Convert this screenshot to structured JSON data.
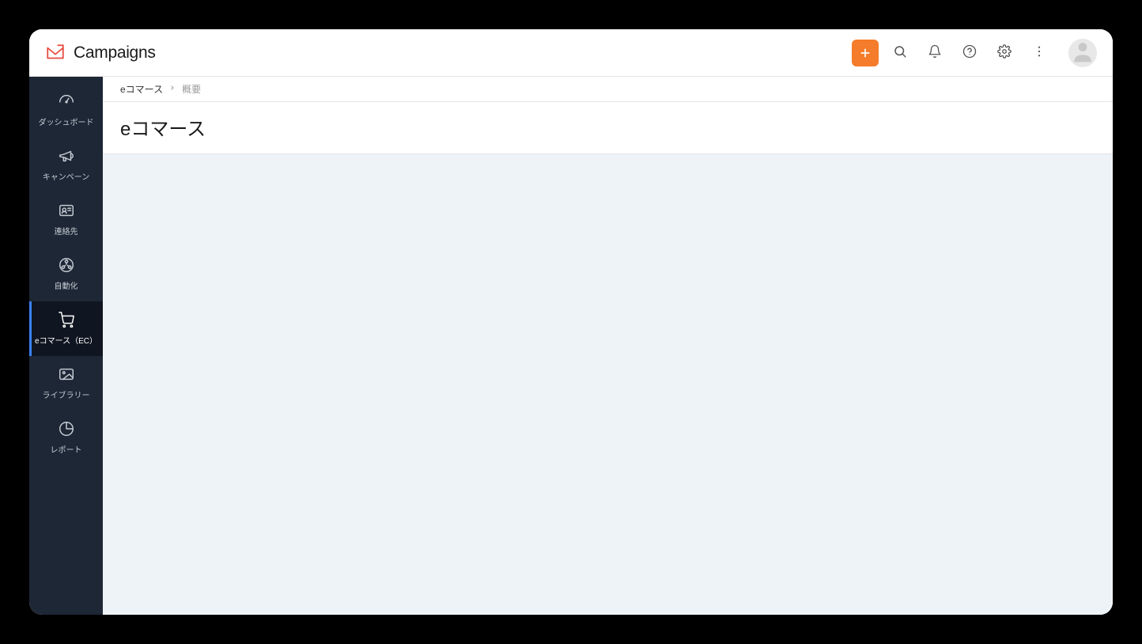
{
  "header": {
    "brand_title": "Campaigns"
  },
  "sidebar": {
    "items": [
      {
        "label": "ダッシュボード",
        "icon": "dashboard",
        "active": false
      },
      {
        "label": "キャンペーン",
        "icon": "megaphone",
        "active": false
      },
      {
        "label": "連絡先",
        "icon": "contacts",
        "active": false
      },
      {
        "label": "自動化",
        "icon": "automation",
        "active": false
      },
      {
        "label": "eコマース（EC）",
        "icon": "cart",
        "active": true
      },
      {
        "label": "ライブラリー",
        "icon": "library",
        "active": false
      },
      {
        "label": "レポート",
        "icon": "report",
        "active": false
      }
    ]
  },
  "breadcrumb": {
    "root": "eコマース",
    "current": "概要"
  },
  "page": {
    "title": "eコマース"
  }
}
